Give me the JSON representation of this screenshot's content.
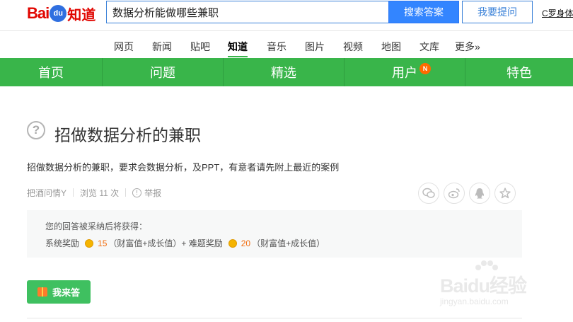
{
  "header": {
    "logo": {
      "bai": "Bai",
      "du": "du",
      "zhidao": "知道"
    },
    "search_value": "数据分析能做哪些兼职",
    "search_button": "搜索答案",
    "ask_button": "我要提问",
    "user_name": "C罗身体"
  },
  "channels": {
    "items": [
      {
        "label": "网页"
      },
      {
        "label": "新闻"
      },
      {
        "label": "贴吧"
      },
      {
        "label": "知道",
        "active": true
      },
      {
        "label": "音乐"
      },
      {
        "label": "图片"
      },
      {
        "label": "视频"
      },
      {
        "label": "地图"
      },
      {
        "label": "文库"
      },
      {
        "label": "更多»"
      }
    ]
  },
  "greennav": {
    "items": [
      {
        "label": "首页"
      },
      {
        "label": "问题"
      },
      {
        "label": "精选"
      },
      {
        "label": "用户",
        "badge": "N"
      },
      {
        "label": "特色"
      }
    ]
  },
  "question": {
    "icon_text": "?",
    "title": "招做数据分析的兼职",
    "description": "招做数据分析的兼职，要求会数据分析，及PPT，有意者请先附上最近的案例",
    "author": "把酒问情Y",
    "views": "浏览 11 次",
    "report": "举报",
    "warn_glyph": "!"
  },
  "share": [
    "wechat-icon",
    "weibo-icon",
    "qq-icon",
    "star-icon"
  ],
  "reward": {
    "title": "您的回答被采纳后将获得：",
    "system_label": "系统奖励",
    "system_value": "15",
    "system_unit": "（财富值+成长值）+ 难题奖励",
    "extra_value": "20",
    "extra_unit": "（财富值+成长值）"
  },
  "answer_button": "我来答",
  "watermark": {
    "main": "Baidu经验",
    "sub": "jingyan.baidu.com"
  },
  "colors": {
    "green": "#39b54a",
    "blue": "#3385ff",
    "logo_red": "#e10601",
    "reward_number": "#f26c0d"
  }
}
